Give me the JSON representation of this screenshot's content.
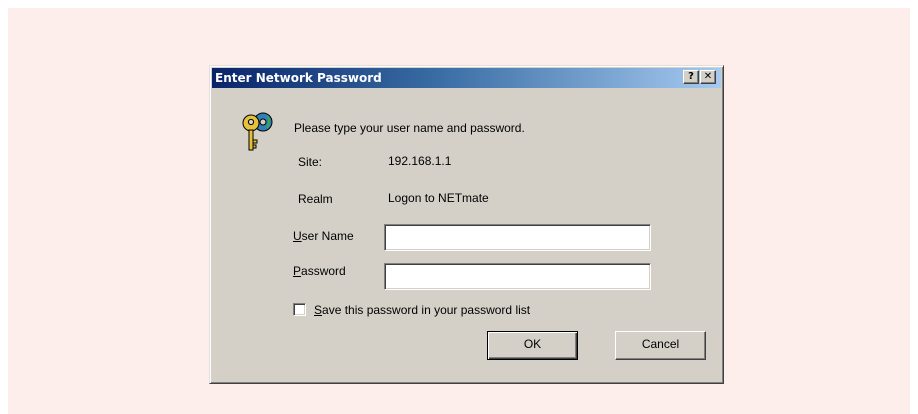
{
  "dialog": {
    "title": "Enter Network Password",
    "help_button": "?",
    "close_button": "✕",
    "prompt": "Please type your user name and password.",
    "site_label": "Site:",
    "site_value": "192.168.1.1",
    "realm_label": "Realm",
    "realm_value": "Logon to NETmate",
    "username_label_accel": "U",
    "username_label_rest": "ser Name",
    "username_value": "",
    "password_label_accel": "P",
    "password_label_rest": "assword",
    "password_value": "",
    "save_password_checked": false,
    "save_password_accel": "S",
    "save_password_rest": "ave this password in your password list",
    "ok_label": "OK",
    "cancel_label": "Cancel"
  },
  "icons": {
    "dialog_icon": "keys-icon"
  },
  "colors": {
    "titlebar_start": "#0a246a",
    "titlebar_end": "#a6caf0",
    "dialog_face": "#d4d0c8",
    "backdrop": "#fdeeec"
  }
}
